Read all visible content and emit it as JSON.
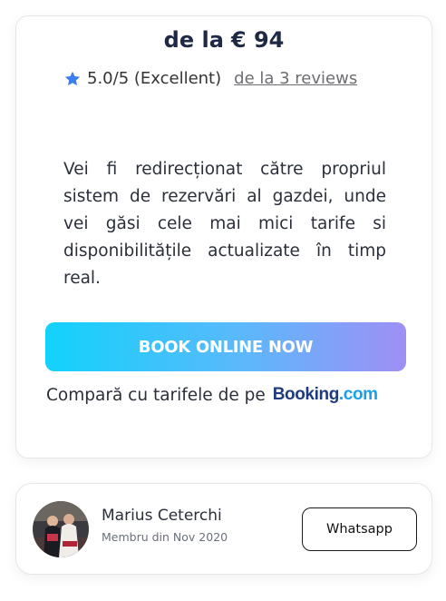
{
  "price": {
    "prefix": "de la",
    "amount": "€ 94"
  },
  "rating": {
    "icon": "star-icon",
    "score": "5.0/5 (Excellent)",
    "reviews_link": "de la 3 reviews",
    "star_color": "#3d7ff0"
  },
  "description": "Vei fi redirecționat către propriul sistem de rezervări al gazdei, unde vei găsi cele mai mici tarife si disponibilitățile actualizate în timp real.",
  "book_button": {
    "label": "BOOK ONLINE NOW",
    "gradient": [
      "#12d2fb",
      "#9f8ff5"
    ]
  },
  "compare": {
    "text": "Compară cu tarifele de pe",
    "booking_logo": {
      "name": "Booking",
      "dot": ".",
      "tld": "com"
    }
  },
  "host": {
    "name": "Marius Ceterchi",
    "member_since": "Membru din Nov 2020",
    "whatsapp_label": "Whatsapp"
  }
}
